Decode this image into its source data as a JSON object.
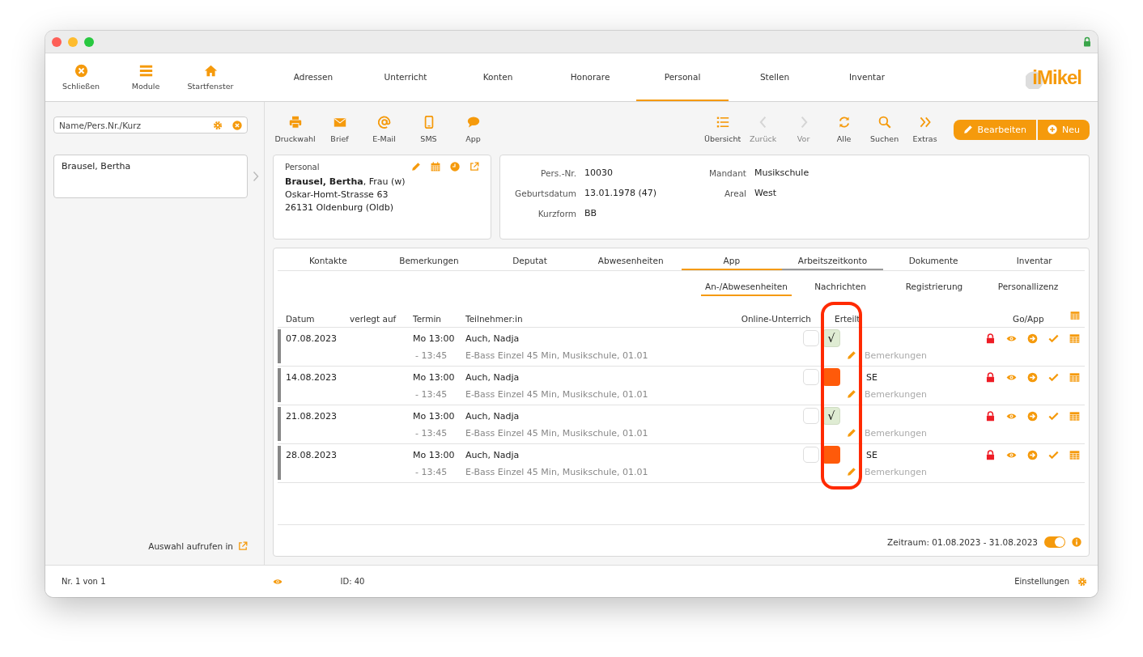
{
  "logo": "iMikel",
  "app_buttons": [
    {
      "label": "Schließen",
      "kind": "close"
    },
    {
      "label": "Module",
      "kind": "menu"
    },
    {
      "label": "Startfenster",
      "kind": "home"
    }
  ],
  "nav_tabs": [
    {
      "label": "Adressen",
      "selected": false
    },
    {
      "label": "Unterricht",
      "selected": false
    },
    {
      "label": "Konten",
      "selected": false
    },
    {
      "label": "Honorare",
      "selected": false
    },
    {
      "label": "Personal",
      "selected": true
    },
    {
      "label": "Stellen",
      "selected": false
    },
    {
      "label": "Inventar",
      "selected": false
    }
  ],
  "sidebar": {
    "search": {
      "placeholder": "Name/Pers.Nr./Kurz"
    },
    "items": [
      {
        "label": "Brausel, Bertha",
        "selected": false
      }
    ],
    "link": "Auswahl aufrufen in"
  },
  "toolbar_left": [
    {
      "label": "Druckwahl",
      "kind": "print",
      "disabled": false
    },
    {
      "label": "Brief",
      "kind": "mail",
      "disabled": false
    },
    {
      "label": "E-Mail",
      "kind": "at",
      "disabled": false
    },
    {
      "label": "SMS",
      "kind": "phone",
      "disabled": false
    },
    {
      "label": "App",
      "kind": "chat",
      "disabled": false
    }
  ],
  "toolbar_right": [
    {
      "label": "Übersicht",
      "kind": "list",
      "disabled": false
    },
    {
      "label": "Zurück",
      "kind": "prev",
      "disabled": true
    },
    {
      "label": "Vor",
      "kind": "next",
      "disabled": true
    },
    {
      "label": "Alle",
      "kind": "refresh",
      "disabled": false
    },
    {
      "label": "Suchen",
      "kind": "search",
      "disabled": false
    },
    {
      "label": "Extras",
      "kind": "more",
      "disabled": false
    }
  ],
  "buttons": [
    {
      "label": "Bearbeiten",
      "kind": "edit"
    },
    {
      "label": "Neu",
      "kind": "add"
    }
  ],
  "personal_card": {
    "title": "Personal",
    "lines": [
      "**Brausel, Bertha**, Frau (w)",
      "Oskar-Homt-Strasse 63",
      "26131 Oldenburg (Oldb)"
    ]
  },
  "details": {
    "left": [
      {
        "label": "Pers.-Nr.",
        "value": "10030"
      },
      {
        "label": "Geburtsdatum",
        "value": "13.01.1978 (47)"
      },
      {
        "label": "Kurzform",
        "value": "BB"
      }
    ],
    "right": [
      {
        "label": "Mandant",
        "value": "Musikschule"
      },
      {
        "label": "Areal",
        "value": "West"
      }
    ]
  },
  "detail_tabs": [
    {
      "label": "Kontakte",
      "selected": false,
      "marked": false
    },
    {
      "label": "Bemerkungen",
      "selected": false,
      "marked": false
    },
    {
      "label": "Deputat",
      "selected": false,
      "marked": false
    },
    {
      "label": "Abwesenheiten",
      "selected": false,
      "marked": false
    },
    {
      "label": "App",
      "selected": true,
      "marked": false
    },
    {
      "label": "Arbeitszeitkonto",
      "selected": false,
      "marked": true
    },
    {
      "label": "Dokumente",
      "selected": false,
      "marked": false
    },
    {
      "label": "Inventar",
      "selected": false,
      "marked": false
    }
  ],
  "sub_tabs": [
    {
      "label": "An-/Abwesenheiten",
      "selected": true
    },
    {
      "label": "Nachrichten",
      "selected": false
    },
    {
      "label": "Registrierung",
      "selected": false
    },
    {
      "label": "Personallizenz",
      "selected": false
    }
  ],
  "table": {
    "columns": [
      "Datum",
      "verlegt auf",
      "Termin",
      "Teilnehmer:in",
      "Online-Unterrich",
      "Erteilt",
      "Go/App"
    ],
    "rows": [
      {
        "date": "07.08.2023",
        "start": "Mo 13:00",
        "end": "- 13:45",
        "participant": "Auch, Nadja",
        "course": "E-Bass Einzel 45 Min, Musikschule, 01.01",
        "online": false,
        "given": true,
        "given_mark": "√",
        "remark_placeholder": "Bemerkungen"
      },
      {
        "date": "14.08.2023",
        "start": "Mo 13:00",
        "end": "- 13:45",
        "participant": "Auch, Nadja",
        "course": "E-Bass Einzel 45 Min, Musikschule, 01.01",
        "online": false,
        "given": false,
        "note": "SE",
        "remark_placeholder": "Bemerkungen"
      },
      {
        "date": "21.08.2023",
        "start": "Mo 13:00",
        "end": "- 13:45",
        "participant": "Auch, Nadja",
        "course": "E-Bass Einzel 45 Min, Musikschule, 01.01",
        "online": false,
        "given": true,
        "given_mark": "√",
        "remark_placeholder": "Bemerkungen"
      },
      {
        "date": "28.08.2023",
        "start": "Mo 13:00",
        "end": "- 13:45",
        "participant": "Auch, Nadja",
        "course": "E-Bass Einzel 45 Min, Musikschule, 01.01",
        "online": false,
        "given": false,
        "note": "SE",
        "remark_placeholder": "Bemerkungen"
      }
    ]
  },
  "annotation": {
    "visible": true
  },
  "footer": {
    "period": "Zeitraum: 01.08.2023 - 31.08.2023",
    "toggle_on": true
  },
  "status_bar": {
    "record": "Nr. 1 von 1",
    "id": "ID: 40",
    "settings": "Einstellungen"
  }
}
